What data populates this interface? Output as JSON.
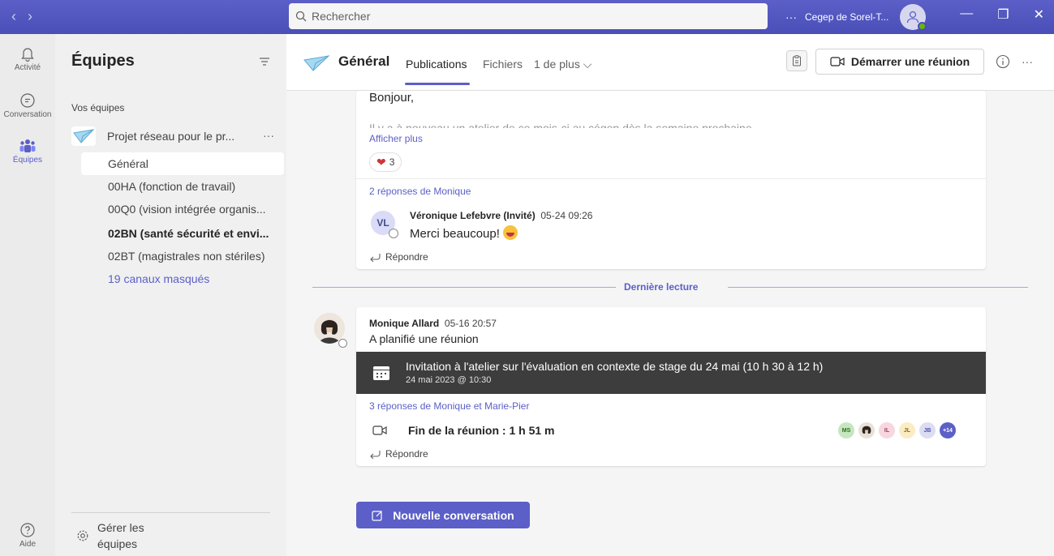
{
  "titlebar": {
    "search_placeholder": "Rechercher",
    "more": "···",
    "org_name": "Cegep de Sorel-T..."
  },
  "rail": {
    "items": [
      {
        "label": "Activité",
        "icon": "bell-icon"
      },
      {
        "label": "Conversation",
        "icon": "chat-icon"
      },
      {
        "label": "Équipes",
        "icon": "teams-icon"
      }
    ],
    "help": {
      "label": "Aide",
      "icon": "help-icon"
    }
  },
  "teams_panel": {
    "title": "Équipes",
    "section_label": "Vos équipes",
    "team_name": "Projet réseau pour le pr...",
    "team_more": "···",
    "channels": [
      {
        "label": "Général"
      },
      {
        "label": "00HA (fonction de travail)"
      },
      {
        "label": "00Q0 (vision intégrée organis..."
      },
      {
        "label": "02BN (santé sécurité et envi..."
      },
      {
        "label": "02BT (magistrales non stériles)"
      },
      {
        "label": "19 canaux masqués"
      }
    ],
    "footer_label": "Gérer les équipes"
  },
  "channel_header": {
    "title": "Général",
    "tabs": [
      {
        "label": "Publications"
      },
      {
        "label": "Fichiers"
      },
      {
        "label": "1 de plus ⌵"
      }
    ],
    "meet_button": "Démarrer une réunion",
    "more": "···"
  },
  "post1": {
    "text": "Bonjour,",
    "truncated_text": "Il y a à nouveau un atelier de ce mois-ci au cégep dès la semaine prochaine",
    "show_more": "Afficher plus",
    "reaction_count": "3",
    "replies_label": "2 réponses de Monique",
    "reply": {
      "initials": "VL",
      "author": "Véronique Lefebvre (Invité)",
      "time": "05-24 09:26",
      "text": "Merci beaucoup!"
    },
    "reply_action": "Répondre"
  },
  "last_read": "Dernière lecture",
  "post2": {
    "author": "Monique Allard",
    "time": "05-16 20:57",
    "text": "A planifié une réunion",
    "invite_title": "Invitation à l'atelier sur l'évaluation en contexte de stage du 24 mai (10 h 30 à 12 h)",
    "invite_date": "24 mai 2023 @ 10:30",
    "replies_label": "3 réponses de Monique et Marie-Pier",
    "meeting_end": "Fin de la réunion : 1 h 51 m",
    "participants": [
      {
        "initials": "MS",
        "bg": "#c6e6c0",
        "fg": "#2e6b1f"
      },
      {
        "initials": "",
        "bg": "#e8e1d8",
        "fg": "#242424"
      },
      {
        "initials": "IL",
        "bg": "#f7d7e0",
        "fg": "#a33b62"
      },
      {
        "initials": "JL",
        "bg": "#fbecc4",
        "fg": "#8a6a14"
      },
      {
        "initials": "JB",
        "bg": "#dcdcf2",
        "fg": "#4f52b2"
      },
      {
        "initials": "+14",
        "bg": "#5b5fc7",
        "fg": "#ffffff"
      }
    ],
    "reply_action": "Répondre"
  },
  "new_conversation": "Nouvelle conversation",
  "colors": {
    "accent": "#5b5fc7",
    "titlebar": "#4a4fb8",
    "invite_bg": "#3d3d3d"
  }
}
